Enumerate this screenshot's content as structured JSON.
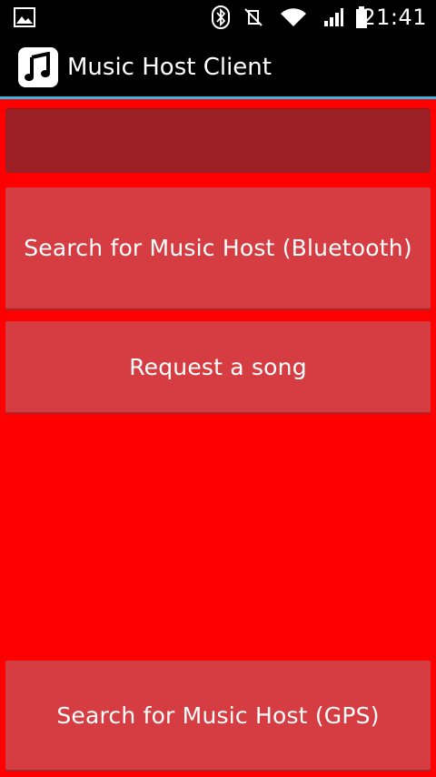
{
  "status_bar": {
    "time": "21:41",
    "icons": [
      "gallery-icon",
      "bluetooth-icon",
      "vibrate-muted-icon",
      "wifi-icon",
      "signal-icon",
      "battery-icon"
    ]
  },
  "action_bar": {
    "title": "Music Host Client",
    "app_icon": "music-note-icon",
    "accent_color": "#33b5e5"
  },
  "main": {
    "input_value": "",
    "buttons": {
      "search_bluetooth": "Search for Music Host (Bluetooth)",
      "request_song": "Request a song",
      "search_gps": "Search for Music Host (GPS)"
    }
  },
  "colors": {
    "background": "#ff0000",
    "button": "#d63d43",
    "input": "#9b1f24"
  }
}
